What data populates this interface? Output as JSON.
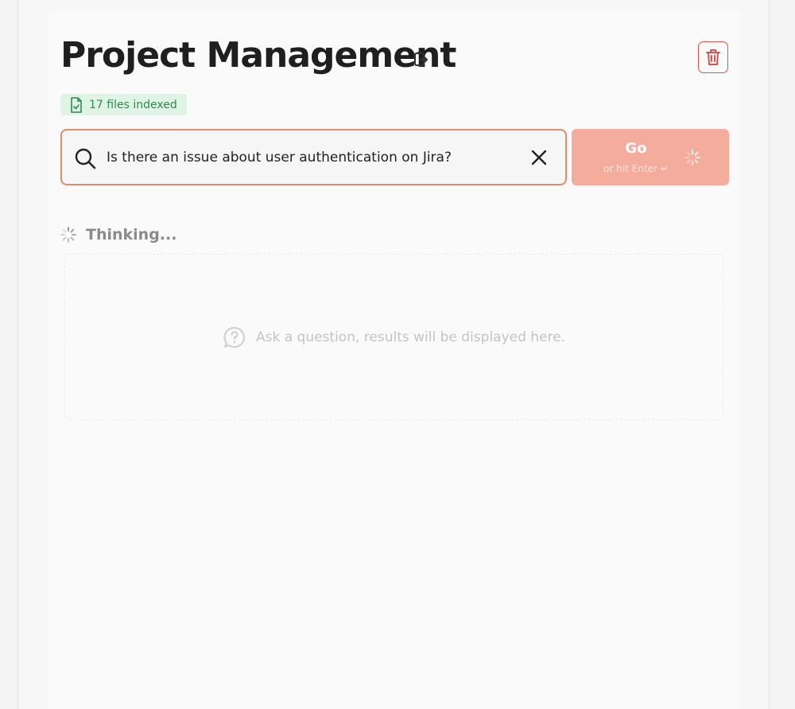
{
  "project": {
    "title": "Project Management",
    "files_indexed": "17 files indexed"
  },
  "search": {
    "value": "Is there an issue about user authentication on Jira?"
  },
  "go_button": {
    "label": "Go",
    "hint": "or hit Enter ↵"
  },
  "status": {
    "thinking": "Thinking..."
  },
  "results": {
    "placeholder": "Ask a question, results will be displayed here."
  },
  "colors": {
    "accent": "#e58a6a",
    "go_button_bg": "#f4ac9c",
    "danger": "#d9534f",
    "badge_bg": "#dff4e4",
    "badge_text": "#2f8a4e"
  },
  "icons": {
    "copy": "copy-icon",
    "delete": "trash-icon",
    "badge": "file-check-icon",
    "search": "search-icon",
    "clear": "close-icon",
    "spinner": "spinner-icon",
    "results": "chat-question-icon"
  }
}
